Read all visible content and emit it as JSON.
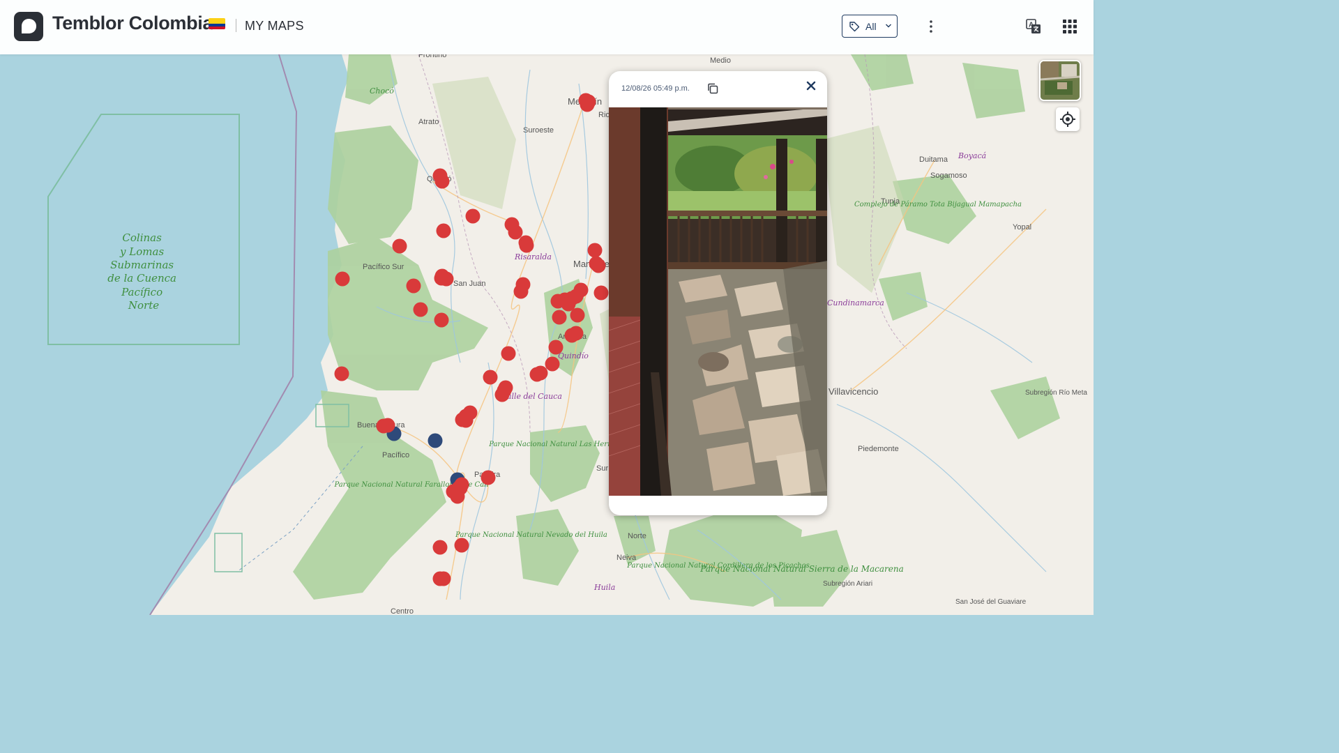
{
  "header": {
    "app_title": "Temblor Colombia",
    "section_label": "MY MAPS",
    "flag_colors": [
      "#fcd116",
      "#003893",
      "#ce1126"
    ],
    "tag_filter": {
      "icon": "tag-icon",
      "value": "All",
      "dropdown_icon": "chevron-down-icon"
    },
    "more_menu_icon": "kebab-menu-icon",
    "translate_icon": "translate-icon",
    "apps_icon": "apps-grid-icon"
  },
  "map_controls": {
    "layer_switcher_icon": "satellite-layer-thumbnail",
    "locate_icon": "crosshair-icon"
  },
  "map_labels": {
    "places": [
      "Medio",
      "Frontino",
      "Chocó",
      "Atrato",
      "Suroeste",
      "Medellín",
      "Rio",
      "Quibdó",
      "Risaralda",
      "Manizales",
      "Pacífico Sur",
      "San Juan",
      "Armenia",
      "Quindío",
      "Valle del Cauca",
      "Buenaventura",
      "Pacífico",
      "Palmira",
      "Sur",
      "Norte",
      "Neiva",
      "Huila",
      "Duitama",
      "Sogamoso",
      "Tunja",
      "Boyacá",
      "Yopal",
      "Cundinamarca",
      "Villavicencio",
      "Piedemonte",
      "Subregión Río Meta",
      "Subregión Ariari",
      "San José del Guaviare",
      "Centro"
    ],
    "marine_area": "Colinas y Lomas Submarinas de la Cuenca Pacífico Norte",
    "parks": [
      "Parque Nacional Natural Farallones de Cali",
      "Parque Nacional Natural Las Hermosas",
      "Parque Nacional Natural Nevado del Huila",
      "Parque Nacional Natural Cordillera de los Picachos",
      "Parque Nacional Natural Sierra de la Macarena",
      "Complejo de Páramo Tota Bijagual Mamapacha"
    ]
  },
  "markers": {
    "colors": {
      "report": "#d93a3a",
      "other": "#2e4a7a"
    },
    "report_count": 62,
    "other_count": 3
  },
  "popup": {
    "timestamp": "12/08/26 05:49 p.m.",
    "copy_icon": "copy-icon",
    "close_icon": "close-icon",
    "photo_icon": "damage-photo"
  }
}
